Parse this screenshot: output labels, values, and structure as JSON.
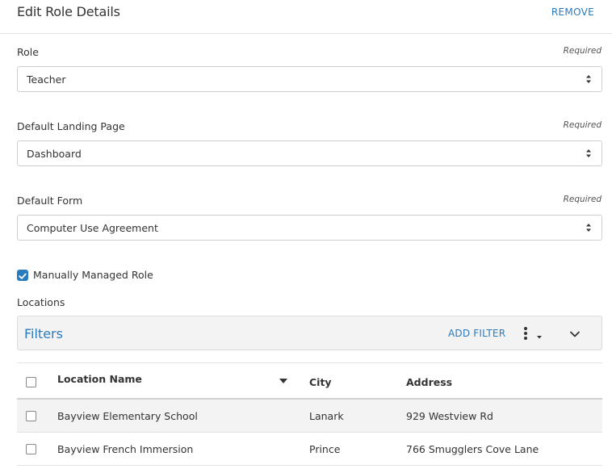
{
  "header": {
    "title": "Edit Role Details",
    "remove_label": "REMOVE"
  },
  "fields": [
    {
      "label": "Role",
      "required": "Required",
      "value": "Teacher"
    },
    {
      "label": "Default Landing Page",
      "required": "Required",
      "value": "Dashboard"
    },
    {
      "label": "Default Form",
      "required": "Required",
      "value": "Computer Use Agreement"
    }
  ],
  "manual": {
    "label": "Manually Managed Role",
    "checked": true
  },
  "locations": {
    "label": "Locations",
    "filters": {
      "title": "Filters",
      "add_label": "ADD FILTER"
    },
    "columns": [
      "Location Name",
      "City",
      "Address"
    ],
    "rows": [
      {
        "name": "Bayview Elementary School",
        "city": "Lanark",
        "address": "929 Westview Rd"
      },
      {
        "name": "Bayview French Immersion",
        "city": "Prince",
        "address": "766 Smugglers Cove Lane"
      }
    ]
  },
  "colors": {
    "accent": "#2a7bbd",
    "border": "#cfcfcf",
    "row_alt": "#f3f3f3"
  },
  "icons": [
    "select-caret-icon",
    "check-icon",
    "kebab-icon",
    "caret-down-icon",
    "chevron-down-icon",
    "sort-down-icon"
  ]
}
